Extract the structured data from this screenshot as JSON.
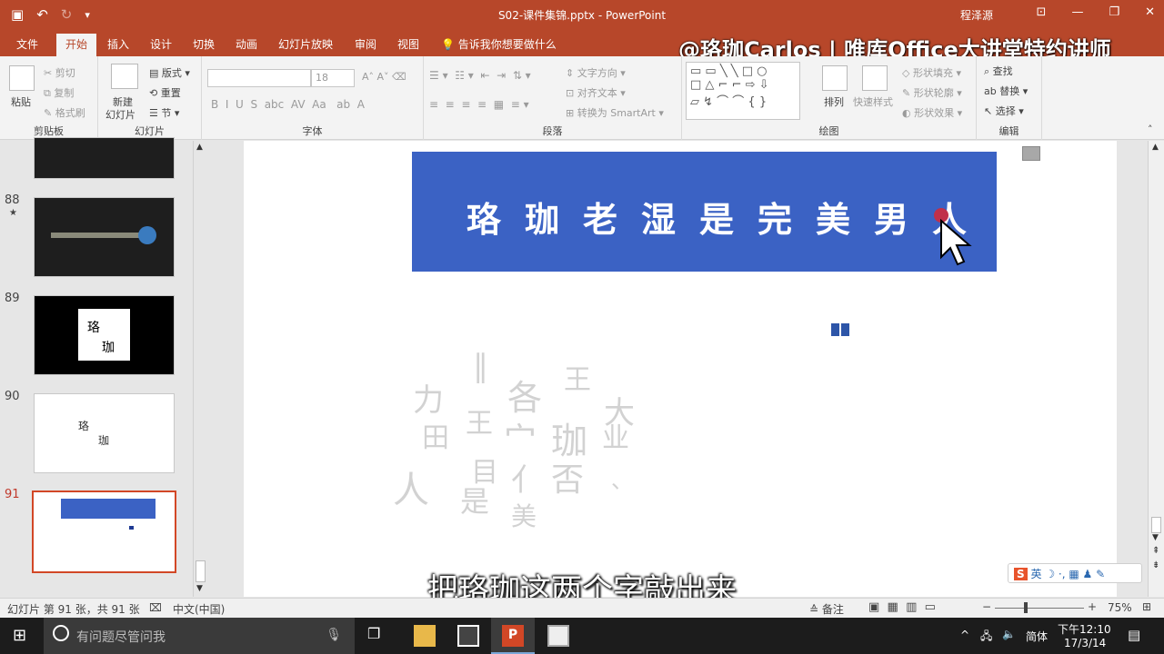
{
  "titlebar": {
    "document_title": "S02-课件集锦.pptx - PowerPoint",
    "user": "程泽源"
  },
  "tabs": [
    "文件",
    "开始",
    "插入",
    "设计",
    "切换",
    "动画",
    "幻灯片放映",
    "审阅",
    "视图"
  ],
  "tell_me": "告诉我你想要做什么",
  "watermark": "@珞珈Carlos | 唯库Office大讲堂特约讲师",
  "ribbon": {
    "clipboard": {
      "paste": "粘贴",
      "cut": "剪切",
      "copy": "复制",
      "format_painter": "格式刷",
      "label": "剪贴板"
    },
    "slides": {
      "new_slide": "新建",
      "new_slide2": "幻灯片",
      "layout": "版式",
      "reset": "重置",
      "section": "节",
      "label": "幻灯片"
    },
    "font": {
      "size": "18",
      "label": "字体"
    },
    "paragraph": {
      "text_direction": "文字方向",
      "align_text": "对齐文本",
      "smartart": "转换为 SmartArt",
      "label": "段落"
    },
    "drawing": {
      "arrange": "排列",
      "quick_styles": "快速样式",
      "shape_fill": "形状填充",
      "shape_outline": "形状轮廓",
      "shape_effects": "形状效果",
      "label": "绘图"
    },
    "editing": {
      "find": "查找",
      "replace": "替换",
      "select": "选择",
      "label": "编辑"
    }
  },
  "thumbnails": [
    {
      "num": "88",
      "star": "★"
    },
    {
      "num": "89",
      "char1": "珞",
      "char2": "珈"
    },
    {
      "num": "90",
      "char1": "珞",
      "char2": "珈"
    },
    {
      "num": "91"
    }
  ],
  "slide": {
    "banner_text": "珞珈老湿是完美男人"
  },
  "status": {
    "slide_info": "幻灯片 第 91 张，共 91 张",
    "language": "中文(中国)",
    "notes": "备注",
    "zoom": "75%"
  },
  "subtitle": "把珞珈这两个字敲出来",
  "ime": {
    "lang": "英"
  },
  "taskbar": {
    "search_placeholder": "有问题尽管问我",
    "ime_mode": "简体",
    "time": "下午12:10",
    "date": "17/3/14"
  }
}
